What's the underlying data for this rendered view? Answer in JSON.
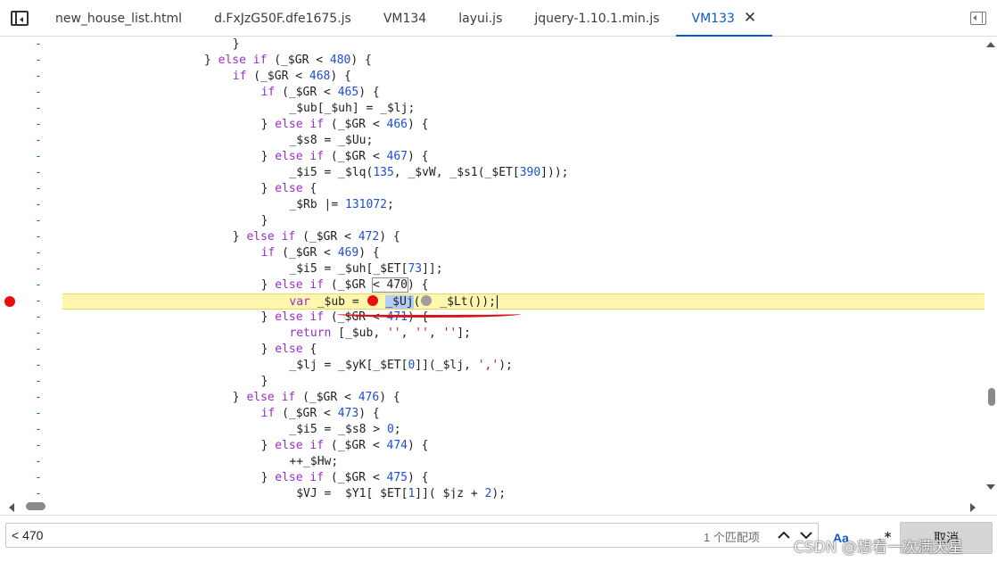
{
  "tabs": [
    {
      "label": "new_house_list.html",
      "active": false
    },
    {
      "label": "d.FxJzG50F.dfe1675.js",
      "active": false
    },
    {
      "label": "VM134",
      "active": false
    },
    {
      "label": "layui.js",
      "active": false
    },
    {
      "label": "jquery-1.10.1.min.js",
      "active": false
    },
    {
      "label": "VM133",
      "active": true
    }
  ],
  "icons": {
    "navigator_toggle": "left-sidebar-toggle-icon",
    "tab_close": "close-icon",
    "debugger_toggle": "right-sidebar-toggle-icon",
    "breakpoint": "breakpoint-dot",
    "inline_breakpoint_active": "inline-breakpoint-red",
    "inline_breakpoint_inactive": "inline-breakpoint-gray"
  },
  "colors": {
    "active_tab": "#0b57d0",
    "keyword": "#9a2ec9",
    "number": "#1a4fd6",
    "string": "#b31b1b",
    "execution_line": "#fff7ae",
    "breakpoint": "#e8100c",
    "selection": "#b3cdf4",
    "annotation_underline": "#d6141c"
  },
  "gutter_mark": "-",
  "editor": {
    "breakpoint_line": 16,
    "lines": [
      {
        "indent": 24,
        "parts": [
          [
            "p",
            "}"
          ]
        ]
      },
      {
        "indent": 20,
        "parts": [
          [
            "p",
            "} "
          ],
          [
            "kw",
            "else"
          ],
          [
            "p",
            " "
          ],
          [
            "kw",
            "if"
          ],
          [
            "p",
            " (_$GR < "
          ],
          [
            "num",
            "480"
          ],
          [
            "p",
            ") {"
          ]
        ]
      },
      {
        "indent": 24,
        "parts": [
          [
            "kw",
            "if"
          ],
          [
            "p",
            " (_$GR < "
          ],
          [
            "num",
            "468"
          ],
          [
            "p",
            ") {"
          ]
        ]
      },
      {
        "indent": 28,
        "parts": [
          [
            "kw",
            "if"
          ],
          [
            "p",
            " (_$GR < "
          ],
          [
            "num",
            "465"
          ],
          [
            "p",
            ") {"
          ]
        ]
      },
      {
        "indent": 32,
        "parts": [
          [
            "p",
            "_$ub[_$uh] = _$lj;"
          ]
        ]
      },
      {
        "indent": 28,
        "parts": [
          [
            "p",
            "} "
          ],
          [
            "kw",
            "else"
          ],
          [
            "p",
            " "
          ],
          [
            "kw",
            "if"
          ],
          [
            "p",
            " (_$GR < "
          ],
          [
            "num",
            "466"
          ],
          [
            "p",
            ") {"
          ]
        ]
      },
      {
        "indent": 32,
        "parts": [
          [
            "p",
            "_$s8 = _$Uu;"
          ]
        ]
      },
      {
        "indent": 28,
        "parts": [
          [
            "p",
            "} "
          ],
          [
            "kw",
            "else"
          ],
          [
            "p",
            " "
          ],
          [
            "kw",
            "if"
          ],
          [
            "p",
            " (_$GR < "
          ],
          [
            "num",
            "467"
          ],
          [
            "p",
            ") {"
          ]
        ]
      },
      {
        "indent": 32,
        "parts": [
          [
            "p",
            "_$i5 = _$lq("
          ],
          [
            "num",
            "135"
          ],
          [
            "p",
            ", _$vW, _$s1(_$ET["
          ],
          [
            "num",
            "390"
          ],
          [
            "p",
            "]));"
          ]
        ]
      },
      {
        "indent": 28,
        "parts": [
          [
            "p",
            "} "
          ],
          [
            "kw",
            "else"
          ],
          [
            "p",
            " {"
          ]
        ]
      },
      {
        "indent": 32,
        "parts": [
          [
            "p",
            "_$Rb |= "
          ],
          [
            "num",
            "131072"
          ],
          [
            "p",
            ";"
          ]
        ]
      },
      {
        "indent": 28,
        "parts": [
          [
            "p",
            "}"
          ]
        ]
      },
      {
        "indent": 24,
        "parts": [
          [
            "p",
            "} "
          ],
          [
            "kw",
            "else"
          ],
          [
            "p",
            " "
          ],
          [
            "kw",
            "if"
          ],
          [
            "p",
            " (_$GR < "
          ],
          [
            "num",
            "472"
          ],
          [
            "p",
            ") {"
          ]
        ]
      },
      {
        "indent": 28,
        "parts": [
          [
            "kw",
            "if"
          ],
          [
            "p",
            " (_$GR < "
          ],
          [
            "num",
            "469"
          ],
          [
            "p",
            ") {"
          ]
        ]
      },
      {
        "indent": 32,
        "parts": [
          [
            "p",
            "_$i5 = _$uh[_$ET["
          ],
          [
            "num",
            "73"
          ],
          [
            "p",
            "]];"
          ]
        ]
      },
      {
        "indent": 28,
        "parts": [
          [
            "p",
            "} "
          ],
          [
            "kw",
            "else"
          ],
          [
            "p",
            " "
          ],
          [
            "kw",
            "if"
          ],
          [
            "p",
            " (_$GR "
          ],
          [
            "found",
            "< 470"
          ],
          [
            "p",
            ") {"
          ]
        ]
      },
      {
        "indent": 32,
        "parts": [
          [
            "kw",
            "var"
          ],
          [
            "p",
            " _$ub = "
          ],
          [
            "bpred",
            ""
          ],
          [
            "p",
            " "
          ],
          [
            "sel",
            "_$Uj"
          ],
          [
            "p",
            "("
          ],
          [
            "bpgray",
            ""
          ],
          [
            "p",
            " _$Lt());"
          ],
          [
            "caret",
            ""
          ]
        ]
      },
      {
        "indent": 28,
        "parts": [
          [
            "p",
            "} "
          ],
          [
            "kw",
            "else"
          ],
          [
            "p",
            " "
          ],
          [
            "kw",
            "if"
          ],
          [
            "p",
            " (_$GR < "
          ],
          [
            "num",
            "471"
          ],
          [
            "p",
            ") {"
          ]
        ]
      },
      {
        "indent": 32,
        "parts": [
          [
            "kw",
            "return"
          ],
          [
            "p",
            " [_$ub, "
          ],
          [
            "str",
            "''"
          ],
          [
            "p",
            ", "
          ],
          [
            "str",
            "''"
          ],
          [
            "p",
            ", "
          ],
          [
            "str",
            "''"
          ],
          [
            "p",
            "];"
          ]
        ]
      },
      {
        "indent": 28,
        "parts": [
          [
            "p",
            "} "
          ],
          [
            "kw",
            "else"
          ],
          [
            "p",
            " {"
          ]
        ]
      },
      {
        "indent": 32,
        "parts": [
          [
            "p",
            "_$lj = _$yK[_$ET["
          ],
          [
            "num",
            "0"
          ],
          [
            "p",
            "]](_$lj, "
          ],
          [
            "str",
            "','"
          ],
          [
            "p",
            ");"
          ]
        ]
      },
      {
        "indent": 28,
        "parts": [
          [
            "p",
            "}"
          ]
        ]
      },
      {
        "indent": 24,
        "parts": [
          [
            "p",
            "} "
          ],
          [
            "kw",
            "else"
          ],
          [
            "p",
            " "
          ],
          [
            "kw",
            "if"
          ],
          [
            "p",
            " (_$GR < "
          ],
          [
            "num",
            "476"
          ],
          [
            "p",
            ") {"
          ]
        ]
      },
      {
        "indent": 28,
        "parts": [
          [
            "kw",
            "if"
          ],
          [
            "p",
            " (_$GR < "
          ],
          [
            "num",
            "473"
          ],
          [
            "p",
            ") {"
          ]
        ]
      },
      {
        "indent": 32,
        "parts": [
          [
            "p",
            "_$i5 = _$s8 > "
          ],
          [
            "num",
            "0"
          ],
          [
            "p",
            ";"
          ]
        ]
      },
      {
        "indent": 28,
        "parts": [
          [
            "p",
            "} "
          ],
          [
            "kw",
            "else"
          ],
          [
            "p",
            " "
          ],
          [
            "kw",
            "if"
          ],
          [
            "p",
            " (_$GR < "
          ],
          [
            "num",
            "474"
          ],
          [
            "p",
            ") {"
          ]
        ]
      },
      {
        "indent": 32,
        "parts": [
          [
            "p",
            "++_$Hw;"
          ]
        ]
      },
      {
        "indent": 28,
        "parts": [
          [
            "p",
            "} "
          ],
          [
            "kw",
            "else"
          ],
          [
            "p",
            " "
          ],
          [
            "kw",
            "if"
          ],
          [
            "p",
            " (_$GR < "
          ],
          [
            "num",
            "475"
          ],
          [
            "p",
            ") {"
          ]
        ]
      },
      {
        "indent": 32,
        "parts": [
          [
            "p",
            "_$VJ = _$Y1[_$ET["
          ],
          [
            "num",
            "1"
          ],
          [
            "p",
            "]](_$jz + "
          ],
          [
            "num",
            "2"
          ],
          [
            "p",
            ");"
          ]
        ]
      }
    ]
  },
  "search": {
    "query": "< 470",
    "match_count": "1 个匹配项",
    "case_label": "Aa",
    "regex_label": ".*",
    "cancel_label": "取消"
  },
  "watermark": "CSDN @想看一次满天星"
}
